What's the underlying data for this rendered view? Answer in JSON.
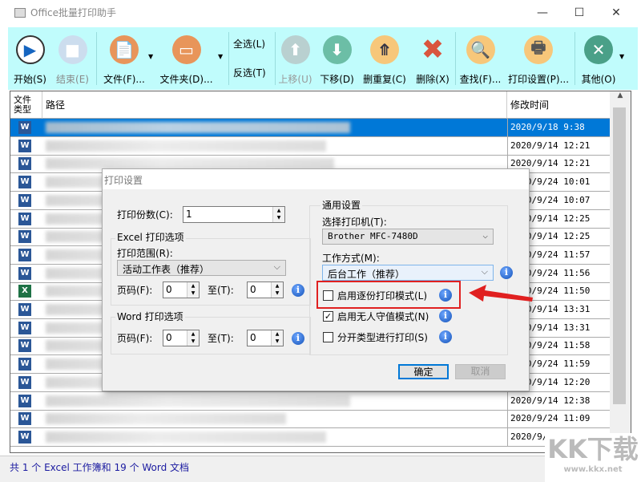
{
  "window": {
    "title": "Office批量打印助手",
    "min": "—",
    "max": "☐",
    "close": "✕"
  },
  "toolbar": {
    "start": "开始(S)",
    "stop": "结束(E)",
    "file": "文件(F)...",
    "folder": "文件夹(D)...",
    "select_all": "全选(L)",
    "invert": "反选(T)",
    "up": "上移(U)",
    "down": "下移(D)",
    "dedupe": "删重复(C)",
    "delete": "删除(X)",
    "find": "查找(F)...",
    "print_settings": "打印设置(P)...",
    "other": "其他(O)"
  },
  "list": {
    "headers": {
      "type": "文件\n类型",
      "path": "路径",
      "time": "修改时间"
    },
    "rows": [
      {
        "type": "W",
        "time": "2020/9/18 9:38"
      },
      {
        "type": "W",
        "time": "2020/9/14 12:21"
      },
      {
        "type": "W",
        "time": "2020/9/14 12:21"
      },
      {
        "type": "W",
        "time": "2020/9/24 10:01"
      },
      {
        "type": "W",
        "time": "2020/9/24 10:07"
      },
      {
        "type": "W",
        "time": "2020/9/14 12:25"
      },
      {
        "type": "W",
        "time": "2020/9/14 12:25"
      },
      {
        "type": "W",
        "time": "2020/9/24 11:57"
      },
      {
        "type": "W",
        "time": "2020/9/24 11:56"
      },
      {
        "type": "X",
        "time": "2020/9/24 11:50"
      },
      {
        "type": "W",
        "time": "2020/9/14 13:31"
      },
      {
        "type": "W",
        "time": "2020/9/14 13:31"
      },
      {
        "type": "W",
        "time": "2020/9/24 11:58"
      },
      {
        "type": "W",
        "time": "2020/9/24 11:59"
      },
      {
        "type": "W",
        "time": "2020/9/14 12:20"
      },
      {
        "type": "W",
        "time": "2020/9/14 12:38"
      },
      {
        "type": "W",
        "time": "2020/9/24 11:09"
      },
      {
        "type": "W",
        "time": "2020/9/1"
      }
    ]
  },
  "status": "共 1 个 Excel 工作簿和 19 个 Word 文档",
  "dialog": {
    "title": "打印设置",
    "copies_label": "打印份数(C):",
    "copies": "1",
    "excel_group": "Excel 打印选项",
    "range_label": "打印范围(R):",
    "range": "活动工作表（推荐）",
    "page_from_label": "页码(F):",
    "page_to_label": "至(T):",
    "excel_from": "0",
    "excel_to": "0",
    "word_group": "Word 打印选项",
    "word_from": "0",
    "word_to": "0",
    "general_group": "通用设置",
    "printer_label": "选择打印机(T):",
    "printer": "Brother MFC-7480D",
    "mode_label": "工作方式(M):",
    "mode": "后台工作（推荐）",
    "collate": "启用逐份打印模式(L)",
    "collate_checked": false,
    "unattended": "启用无人守值模式(N)",
    "unattended_checked": true,
    "separate": "分开类型进行打印(S)",
    "separate_checked": false,
    "ok": "确定",
    "cancel": "取消"
  },
  "watermark": {
    "logo": "KK下载",
    "url": "www.kkx.net"
  },
  "colors": {
    "toolbar": "#c0fcfc",
    "selection": "#0078d7",
    "highlight": "#e02020"
  }
}
